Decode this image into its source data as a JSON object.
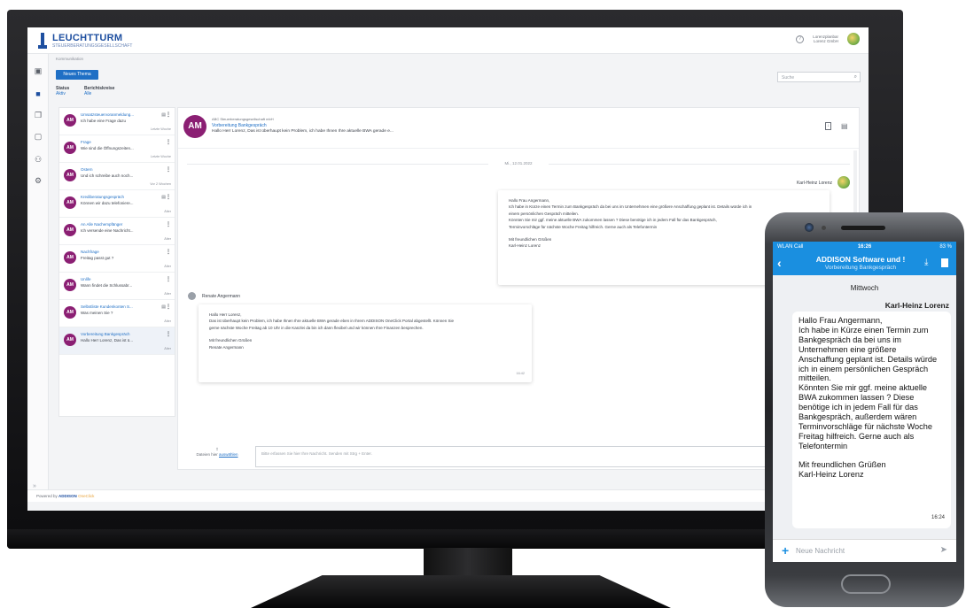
{
  "app": {
    "brand": "LEUCHTTURM",
    "brand_sub": "STEUERBERATUNGSGESELLSCHAFT",
    "user_line1": "Lorenzplanbar",
    "user_line2": "Lorenz GmbH",
    "breadcrumb": "Kommunikation",
    "new_topic_label": "Neues Thema",
    "filter_status_label": "Status",
    "filter_status_value": "Aktiv",
    "filter_berichtskreise_label": "Berichtskreise",
    "filter_berichtskreise_value": "Alle",
    "search_placeholder": "Suche"
  },
  "conversations": [
    {
      "initials": "AM",
      "title": "Umsatzsteuervoranmeldung...",
      "preview": "Ich habe eine Frage dazu",
      "time": "Letzte Woche"
    },
    {
      "initials": "AM",
      "title": "Frage",
      "preview": "Wie sind die Öffnungszeiten...",
      "time": "Letzte Woche"
    },
    {
      "initials": "AM",
      "title": "Ostern",
      "preview": "Und ich schreibe auch noch...",
      "time": "Vor 2 Wochen"
    },
    {
      "initials": "AM",
      "title": "Krediberatungsgespräch",
      "preview": "Können wir dazu telefoniere...",
      "time": "Älter"
    },
    {
      "initials": "AM",
      "title": "An Alle Nachempfänger",
      "preview": "Ich versende eine Nachricht...",
      "time": "Älter"
    },
    {
      "initials": "AM",
      "title": "Nachfrage",
      "preview": "Freitag passt gut ?",
      "time": "Älter"
    },
    {
      "initials": "AM",
      "title": "Unlife",
      "preview": "Wann findet die Schlussabr...",
      "time": "Älter"
    },
    {
      "initials": "AM",
      "title": "Selbstliste Kundenkonten S...",
      "preview": "Was meinen Sie ?",
      "time": "Älter"
    },
    {
      "initials": "AM",
      "title": "Vorbereitung Bankgespräch",
      "preview": "Hallo Herr Lorenz, Das ist ü...",
      "time": "Älter"
    }
  ],
  "thread": {
    "initials": "AM",
    "org": "ABC Steuerberatungsgesellschaft mbH",
    "topic": "Vorbereitung Bankgespräch",
    "preview": "Hallo Herr Lorenz, Das ist überhaupt kein Problem, ich habe Ihnen Ihre aktuelle BWA gerade e...",
    "date": "Mi., 12.01.2022",
    "out_sender": "Karl-Heinz Lorenz",
    "out_lines": [
      "Hallo Frau Angermann,",
      "Ich habe in Kürze einen Termin zum Bankgespräch da bei uns im Unternehmen eine größere Anschaffung geplant ist. Details würde ich in",
      "einem persönlichen Gespräch mitteilen.",
      "Könnten Sie mir ggf. meine aktuelle BWA zukommen lassen ? Diese benötige ich in jedem Fall für das Bankgespräch,",
      "Terminvorschläge für nächste Woche Freitag hilfreich. Gerne auch als Telefontermin",
      "",
      "Mit freundlichen Grüßen",
      "Karl-Heinz Lorenz"
    ],
    "in_sender": "Renate Angermann",
    "in_lines": [
      "Hallo Herr Lorenz,",
      "Das ist überhaupt kein Problem, ich habe Ihnen Ihre aktuelle BWA gerade eben in Ihrem ADDISON OneClick Portal abgestellt. Können Sie",
      "gerne nächste Woche Freitag ab 10 Uhr in die Kanzlei da bin ich dann flexibel und wir können Ihre Finanzen besprechen.",
      "",
      "Mit freundlichen Grüßen",
      "Renate Angermann"
    ],
    "in_time": "16:42",
    "attach_text": "Dateien hier",
    "attach_link": "auswählen",
    "composer_placeholder": "Bitte erfassen Sie hier Ihre Nachricht. Senden mit Strg + Enter."
  },
  "footer": {
    "powered_by": "Powered by",
    "brand": "ADDISON",
    "brand_product": "OneClick"
  },
  "phone": {
    "carrier": "WLAN Call",
    "time": "16:26",
    "battery": "83 %",
    "title": "ADDISON Software und !",
    "subtitle": "Vorbereitung Bankgespräch",
    "day": "Mittwoch",
    "sender": "Karl-Heinz Lorenz",
    "message_lines": [
      "Hallo Frau Angermann,",
      "Ich habe in Kürze einen Termin zum",
      "Bankgespräch da bei uns im",
      "Unternehmen eine größere",
      "Anschaffung geplant ist. Details würde",
      "ich in einem persönlichen Gespräch",
      "mitteilen.",
      "Könnten Sie mir ggf. meine aktuelle",
      "BWA zukommen lassen ? Diese",
      "benötige ich in jedem Fall für das",
      "Bankgespräch, außerdem wären",
      "Terminvorschläge für nächste Woche",
      "Freitag hilfreich. Gerne auch als",
      "Telefontermin",
      "",
      "Mit freundlichen Grüßen",
      "Karl-Heinz Lorenz"
    ],
    "message_time": "16:24",
    "input_placeholder": "Neue Nachricht"
  },
  "colors": {
    "brand_blue": "#1e4fa0",
    "action_blue": "#1f6fc5",
    "avatar_purple": "#8b1f73",
    "phone_header": "#1a8fe0"
  },
  "icons": [
    "help-icon",
    "inbox-icon",
    "chat-icon",
    "document-add-icon",
    "folder-add-icon",
    "users-icon",
    "gear-icon",
    "search-icon",
    "attachment-icon",
    "download-icon",
    "file-icon",
    "back-icon",
    "plus-icon",
    "send-icon",
    "more-icon"
  ]
}
